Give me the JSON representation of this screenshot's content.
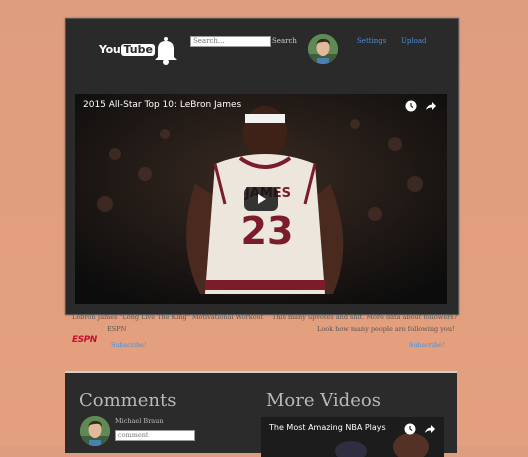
{
  "header": {
    "logo": {
      "you": "You",
      "tube": "Tube"
    },
    "search": {
      "placeholder": "Search...",
      "button_label": "Search"
    },
    "nav": {
      "settings": "Settings",
      "upload": "Upload"
    }
  },
  "video": {
    "title": "2015 All-Star Top 10: LeBron James",
    "jersey_name": "JAMES",
    "jersey_number": "23",
    "icons": [
      "watch-later-icon",
      "share-icon",
      "play-icon"
    ]
  },
  "details": {
    "left_title": "Lebron James \"Long Live The King\" Motivational Workout",
    "channel": "ESPN",
    "channel_logo": "ESPN",
    "subscribe_left": "Subscribe!",
    "right_line1": "This many upvotes and shit. More data about followers?",
    "right_line2": "Look how many people are following you!",
    "subscribe_right": "Subscribe!"
  },
  "comments": {
    "title": "Comments",
    "user": "Michael Braun",
    "input_placeholder": "comment"
  },
  "more_videos": {
    "title": "More Videos",
    "items": [
      {
        "title": "The Most Amazing NBA Plays"
      }
    ]
  },
  "colors": {
    "accent_link": "#4a90d9",
    "panel": "#2a2a2a",
    "background": "#e19e7f",
    "espn": "#c8102e"
  }
}
